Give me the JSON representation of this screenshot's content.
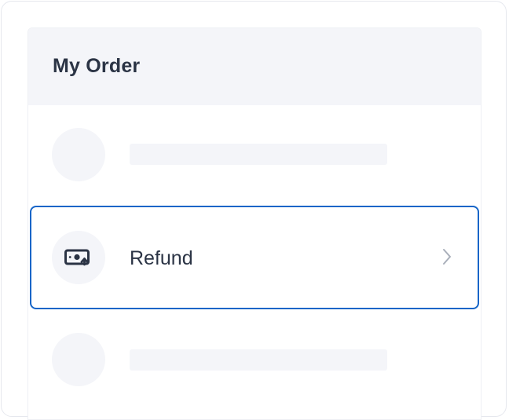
{
  "order_panel": {
    "title": "My Order",
    "items": [
      {
        "type": "placeholder"
      },
      {
        "type": "menu",
        "label": "Refund",
        "icon": "money-refund-icon",
        "selected": true
      },
      {
        "type": "placeholder"
      }
    ]
  },
  "colors": {
    "accent_border": "#1565c8",
    "header_bg": "#f4f5f9",
    "text": "#2b3445",
    "chevron": "#a9afba"
  }
}
